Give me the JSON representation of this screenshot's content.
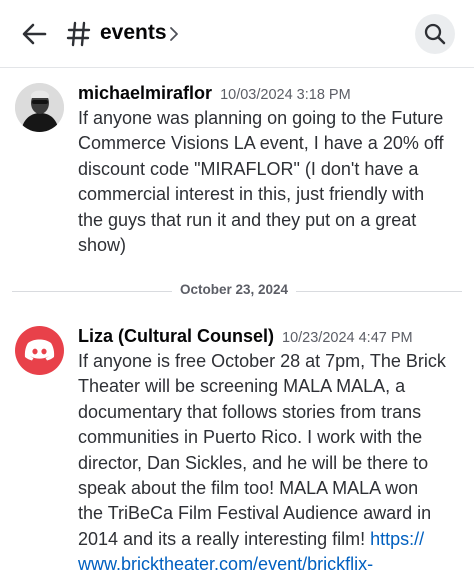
{
  "header": {
    "back_icon": "arrow-left-icon",
    "channel_icon": "hash-icon",
    "channel_name": "events",
    "search_icon": "search-icon"
  },
  "messages": [
    {
      "author": "michaelmiraflor",
      "timestamp": "10/03/2024 3:18 PM",
      "lines": [
        "If anyone was planning on going to the Future",
        "Commerce Visions LA event, I have a 20% off",
        "discount code \"MIRAFLOR\" (I don't have a",
        "commercial interest in this, just friendly with",
        "the guys that run it and they put on a great",
        "show)"
      ]
    },
    {
      "author": "Liza (Cultural Counsel)",
      "timestamp": "10/23/2024 4:47 PM",
      "avatar_color": "#e8414a",
      "lines": [
        "If anyone is free October 28 at 7pm, The Brick",
        "Theater will be screening MALA MALA, a",
        "documentary that follows stories from trans",
        "communities in Puerto Rico.  I work with the",
        "director, Dan Sickles, and he will be there to",
        "speak about the film too! MALA MALA won",
        "the TriBeCa Film Festival Audience award in",
        "2014 and its a really interesting film! "
      ],
      "link_part1": "https://",
      "link_part2": "www.bricktheater.com/event/brickflix-"
    }
  ],
  "date_divider": "October 23, 2024",
  "colors": {
    "link": "#0060c0",
    "discord_red": "#e8414a"
  }
}
